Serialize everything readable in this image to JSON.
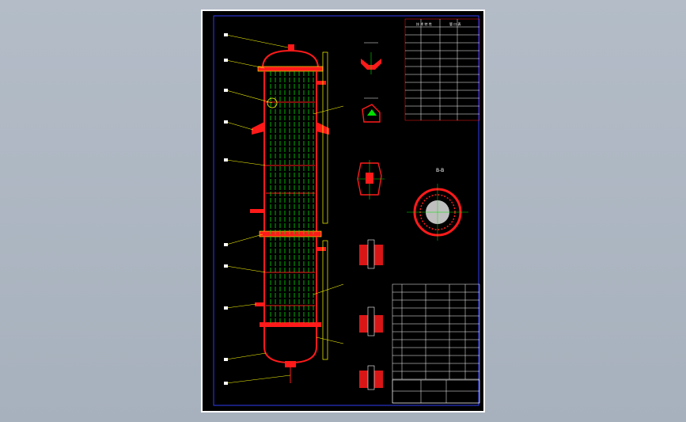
{
  "window": {
    "background_color": "#adb7c2",
    "drawing_background": "#000000"
  },
  "drawing": {
    "label_section": "B-B",
    "table_title_top": "技 术 特 性",
    "table_title_top_right": "管 口 表",
    "colors": {
      "frame": "#2f3cf5",
      "shell": "#ff1a1a",
      "tubes": "#00e000",
      "dims": "#ffff00",
      "table": "#ffffff"
    }
  }
}
